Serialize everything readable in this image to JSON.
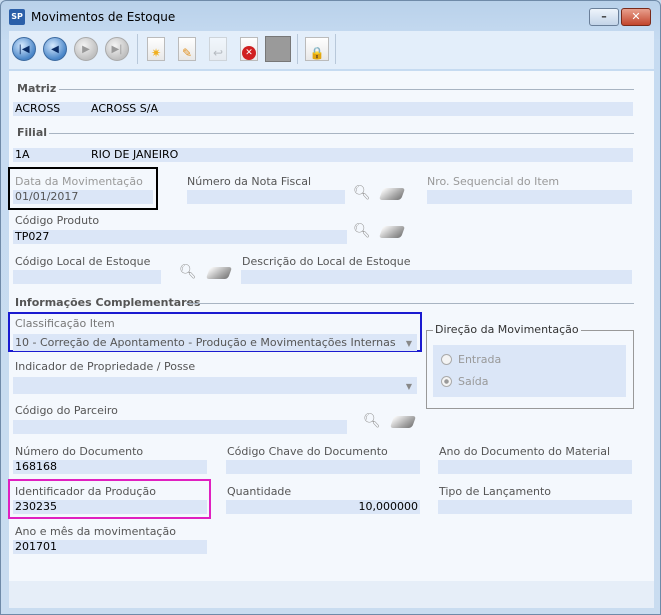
{
  "window": {
    "title": "Movimentos de Estoque",
    "app_icon": "SP"
  },
  "toolbar": {
    "icons": [
      "first-record",
      "previous-record",
      "next-record",
      "last-record",
      "new",
      "edit",
      "undo",
      "delete",
      "save",
      "lock"
    ]
  },
  "matriz": {
    "section": "Matriz",
    "code": "ACROSS",
    "name": "ACROSS S/A"
  },
  "filial": {
    "section": "Filial",
    "code": "1A",
    "name": "RIO DE JANEIRO"
  },
  "fields": {
    "data_mov": {
      "label": "Data da Movimentação",
      "value": "01/01/2017"
    },
    "nota_fiscal": {
      "label": "Número da Nota Fiscal",
      "value": ""
    },
    "seq_item": {
      "label": "Nro. Sequencial do Item",
      "value": ""
    },
    "cod_produto": {
      "label": "Código Produto",
      "value": "TP027"
    },
    "cod_local": {
      "label": "Código Local de Estoque",
      "value": ""
    },
    "desc_local": {
      "label": "Descrição do Local de Estoque",
      "value": ""
    }
  },
  "complementares": {
    "section": "Informações Complementares",
    "classificacao": {
      "label": "Classificação Item",
      "value": "10 - Correção de Apontamento - Produção e Movimentações Internas"
    },
    "indicador": {
      "label": "Indicador de Propriedade / Posse",
      "value": ""
    },
    "direcao": {
      "label": "Direção da Movimentação",
      "options": [
        "Entrada",
        "Saída"
      ],
      "selected": "Saída"
    },
    "parceiro": {
      "label": "Código do Parceiro",
      "value": ""
    },
    "num_doc": {
      "label": "Número do Documento",
      "value": "168168"
    },
    "chave_doc": {
      "label": "Código Chave do Documento",
      "value": ""
    },
    "ano_doc": {
      "label": "Ano do Documento do Material",
      "value": ""
    },
    "id_producao": {
      "label": "Identificador da Produção",
      "value": "230235"
    },
    "quantidade": {
      "label": "Quantidade",
      "value": "10,000000"
    },
    "tipo_lanc": {
      "label": "Tipo de Lançamento",
      "value": ""
    },
    "ano_mes": {
      "label": "Ano e mês da movimentação",
      "value": "201701"
    }
  },
  "colors": {
    "field_bg": "#dbe6f7",
    "highlight_black": "#000000",
    "highlight_blue": "#1a1ad0",
    "highlight_magenta": "#e020c0"
  }
}
